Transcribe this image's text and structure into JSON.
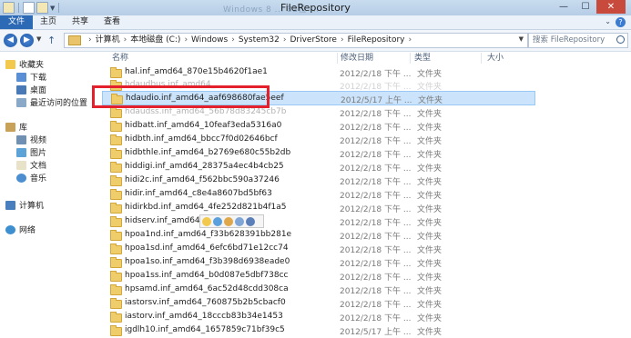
{
  "window": {
    "title": "FileRepository",
    "title_ghost": "Windows 8 ... 32位 ..."
  },
  "ribbon": {
    "tabs": [
      "文件",
      "主页",
      "共享",
      "查看"
    ]
  },
  "address": {
    "crumbs": [
      "计算机",
      "本地磁盘 (C:)",
      "Windows",
      "System32",
      "DriverStore",
      "FileRepository"
    ]
  },
  "search": {
    "placeholder": "搜索 FileRepository"
  },
  "sidebar": {
    "favorites": {
      "label": "收藏夹",
      "items": [
        "下载",
        "桌面",
        "最近访问的位置"
      ]
    },
    "libraries": {
      "label": "库",
      "items": [
        "视频",
        "图片",
        "文档",
        "音乐"
      ]
    },
    "computer": "计算机",
    "network": "网络"
  },
  "columns": {
    "name": "名称",
    "modified": "修改日期",
    "type": "类型",
    "size": "大小"
  },
  "files": [
    {
      "name": "hal.inf_amd64_870e15b4620f1ae1",
      "date": "2012/2/18 下午 ...",
      "type": "文件夹"
    },
    {
      "name": "hdaudbus.inf_amd64_...",
      "date": "2012/2/18 下午 ...",
      "type": "文件夹"
    },
    {
      "name": "hdaudio.inf_amd64_aaf698680fae5eef",
      "date": "2012/5/17 上午 ...",
      "type": "文件夹",
      "selected": true
    },
    {
      "name": "hdaudss.inf_amd64_56b78d83245cb7b",
      "date": "2012/2/18 下午 ...",
      "type": "文件夹"
    },
    {
      "name": "hidbatt.inf_amd64_10feaf3eda5316a0",
      "date": "2012/2/18 下午 ...",
      "type": "文件夹"
    },
    {
      "name": "hidbth.inf_amd64_bbcc7f0d02646bcf",
      "date": "2012/2/18 下午 ...",
      "type": "文件夹"
    },
    {
      "name": "hidbthle.inf_amd64_b2769e680c55b2db",
      "date": "2012/2/18 下午 ...",
      "type": "文件夹"
    },
    {
      "name": "hiddigi.inf_amd64_28375a4ec4b4cb25",
      "date": "2012/2/18 下午 ...",
      "type": "文件夹"
    },
    {
      "name": "hidi2c.inf_amd64_f562bbc590a37246",
      "date": "2012/2/18 下午 ...",
      "type": "文件夹"
    },
    {
      "name": "hidir.inf_amd64_c8e4a8607bd5bf63",
      "date": "2012/2/18 下午 ...",
      "type": "文件夹"
    },
    {
      "name": "hidirkbd.inf_amd64_4fe252d821b4f1a5",
      "date": "2012/2/18 下午 ...",
      "type": "文件夹"
    },
    {
      "name": "hidserv.inf_amd64_a0",
      "date": "2012/2/18 下午 ...",
      "type": "文件夹"
    },
    {
      "name": "hpoa1nd.inf_amd64_f33b628391bb281e",
      "date": "2012/2/18 下午 ...",
      "type": "文件夹"
    },
    {
      "name": "hpoa1sd.inf_amd64_6efc6bd71e12cc74",
      "date": "2012/2/18 下午 ...",
      "type": "文件夹"
    },
    {
      "name": "hpoa1so.inf_amd64_f3b398d6938eade0",
      "date": "2012/2/18 下午 ...",
      "type": "文件夹"
    },
    {
      "name": "hpoa1ss.inf_amd64_b0d087e5dbf738cc",
      "date": "2012/2/18 下午 ...",
      "type": "文件夹"
    },
    {
      "name": "hpsamd.inf_amd64_6ac52d48cdd308ca",
      "date": "2012/2/18 下午 ...",
      "type": "文件夹"
    },
    {
      "name": "iastorsv.inf_amd64_760875b2b5cbacf0",
      "date": "2012/2/18 下午 ...",
      "type": "文件夹"
    },
    {
      "name": "iastorv.inf_amd64_18cccb83b34e1453",
      "date": "2012/2/18 下午 ...",
      "type": "文件夹"
    },
    {
      "name": "igdlh10.inf_amd64_1657859c71bf39c5",
      "date": "2012/5/17 上午 ...",
      "type": "文件夹"
    }
  ],
  "colors": {
    "highlight_box": "#e3202b",
    "selection": "#cce4fb",
    "file_tab": "#2d6ab5"
  }
}
